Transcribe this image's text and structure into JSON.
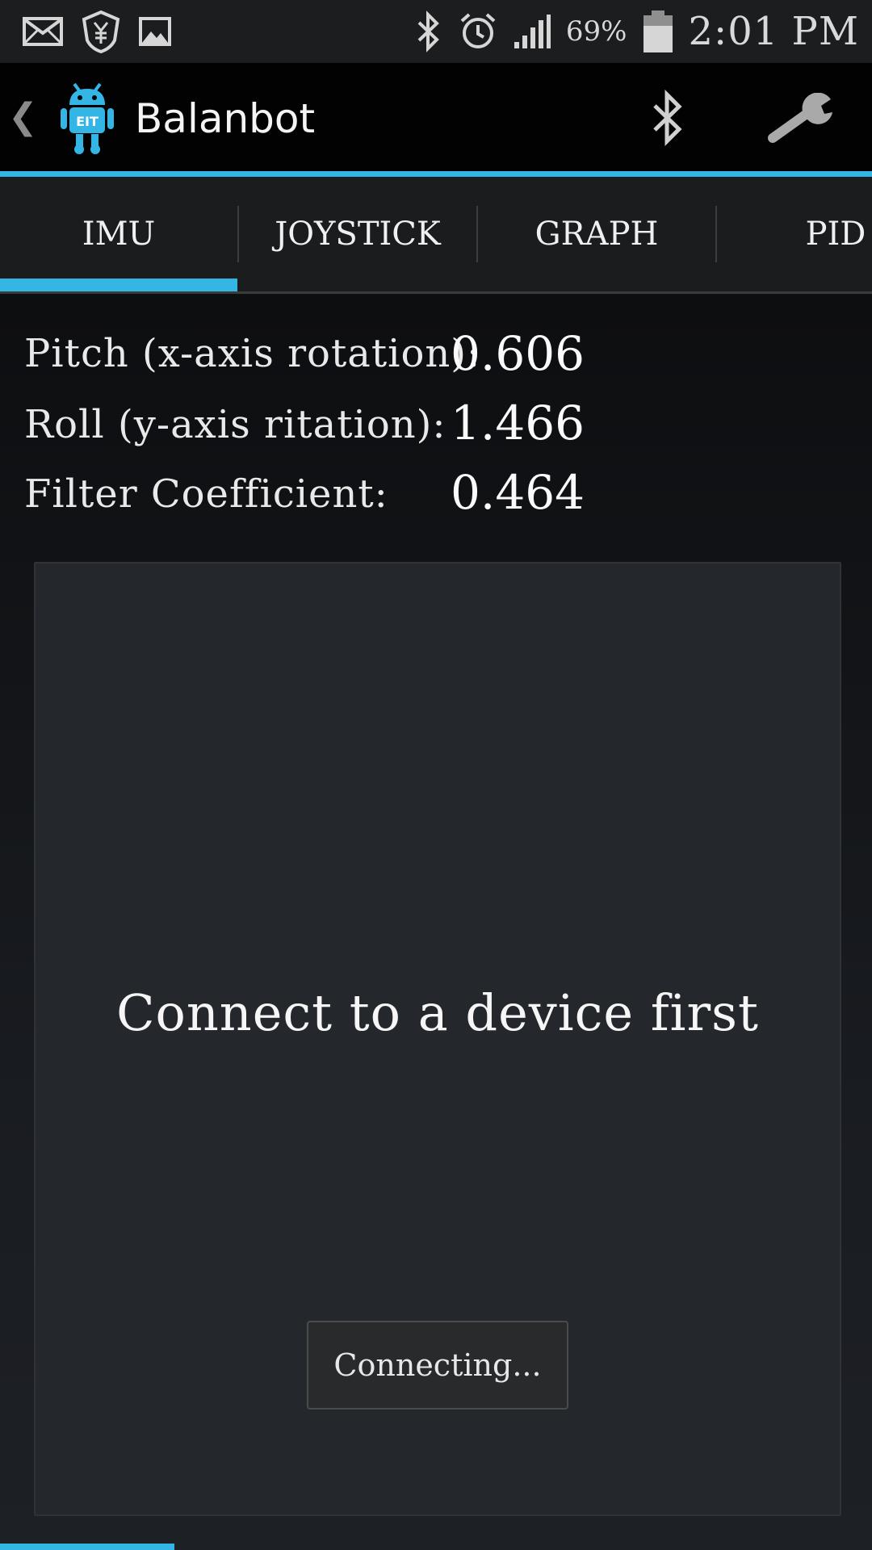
{
  "status_bar": {
    "icons_left": [
      "mail-icon",
      "shield-rupee-icon",
      "gallery-icon"
    ],
    "icons_right": [
      "bluetooth-icon",
      "alarm-icon",
      "signal-icon"
    ],
    "battery_percent": "69%",
    "time": "2:01 PM"
  },
  "action_bar": {
    "title": "Balanbot",
    "logo_text": "EIT",
    "up_icon": "chevron-left-icon",
    "actions": [
      "bluetooth-icon",
      "wrench-icon"
    ]
  },
  "tabs": [
    {
      "label": "IMU",
      "selected": true
    },
    {
      "label": "JOYSTICK",
      "selected": false
    },
    {
      "label": "GRAPH",
      "selected": false
    },
    {
      "label": "PID",
      "selected": false
    }
  ],
  "imu": {
    "pitch_label": "Pitch (x-axis rotation):",
    "pitch_value": "0.606",
    "roll_label": "Roll (y-axis ritation):",
    "roll_value": "1.466",
    "filter_label": "Filter Coefficient:",
    "filter_value": "0.464"
  },
  "panel": {
    "message": "Connect to a device first"
  },
  "toast": {
    "text": "Connecting..."
  },
  "colors": {
    "accent": "#33b5e5",
    "background": "#0d0e10",
    "panel": "#24282d"
  }
}
